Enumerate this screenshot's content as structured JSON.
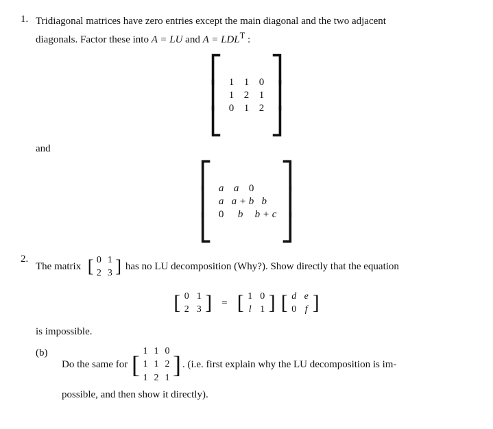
{
  "problem1": {
    "number": "1.",
    "text1": "Tridiagonal matrices have zero entries except the main diagonal and the two adjacent",
    "text2": "diagonals. Factor these into ",
    "eq1": "A = LU",
    "text3": " and ",
    "eq2": "A = LDL",
    "supT": "T",
    "colon": " :",
    "matrix1": {
      "rows": [
        [
          "1",
          "1",
          "0"
        ],
        [
          "1",
          "2",
          "1"
        ],
        [
          "0",
          "1",
          "2"
        ]
      ]
    },
    "and": "and",
    "matrix2": {
      "rows": [
        [
          "a",
          "a",
          "0"
        ],
        [
          "a",
          "a + b",
          "b"
        ],
        [
          "0",
          "b",
          "b + c"
        ]
      ]
    }
  },
  "problem2": {
    "number": "2.",
    "text_pre": "The matrix",
    "inline_matrix": {
      "rows": [
        [
          "0",
          "1"
        ],
        [
          "2",
          "3"
        ]
      ]
    },
    "text_post": "has no LU decomposition (Why?). Show directly that the equation",
    "lhs_matrix": {
      "rows": [
        [
          "0",
          "1"
        ],
        [
          "2",
          "3"
        ]
      ]
    },
    "equals": "=",
    "rhs1_matrix": {
      "rows": [
        [
          "1",
          "0"
        ],
        [
          "l",
          "1"
        ]
      ]
    },
    "rhs2_matrix": {
      "rows": [
        [
          "d",
          "e"
        ],
        [
          "0",
          "f"
        ]
      ]
    },
    "is_impossible": "is impossible.",
    "partb_label": "(b)",
    "partb_text1": "Do the same for",
    "partb_matrix": {
      "rows": [
        [
          "1",
          "1",
          "0"
        ],
        [
          "1",
          "1",
          "2"
        ],
        [
          "1",
          "2",
          "1"
        ]
      ]
    },
    "partb_text2": ". (i.e. first explain why the LU decomposition is im-",
    "partb_text3": "possible, and then show it directly)."
  }
}
